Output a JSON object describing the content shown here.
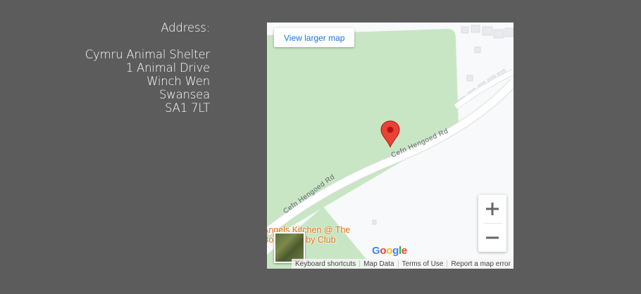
{
  "address": {
    "heading": "Address:",
    "lines": [
      "Cymru Animal Shelter",
      "1 Animal Drive",
      "Winch Wen",
      "Swansea",
      "SA1 7LT"
    ]
  },
  "map": {
    "larger_map_label": "View larger map",
    "road_label_upper": "Cefn Hengoed Rd",
    "road_label_lower": "Cefn Hengoed Rd",
    "poi_lines": [
      "Angels Kitchen @ The",
      "Bo…n Rugby Club"
    ],
    "google_logo": {
      "letters": [
        "G",
        "o",
        "o",
        "g",
        "l",
        "e"
      ],
      "colors": [
        "#4285F4",
        "#EA4335",
        "#FBBC05",
        "#4285F4",
        "#34A853",
        "#EA4335"
      ]
    },
    "footer": [
      "Keyboard shortcuts",
      "Map Data",
      "Terms of Use",
      "Report a map error"
    ],
    "zoom_in_icon": "plus-icon",
    "zoom_out_icon": "minus-icon",
    "pin_icon": "map-pin-icon",
    "pin_color": "#EA4335",
    "park_color": "#c8e6c4",
    "road_color": "#ffffff"
  }
}
